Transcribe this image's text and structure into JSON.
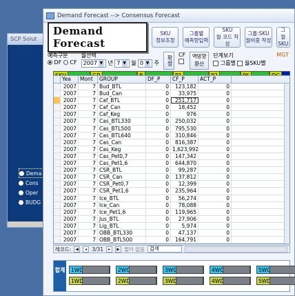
{
  "bg_window": {
    "title": "SCP Solut",
    "radios": [
      "Dema",
      "Cons",
      "Oper",
      "BUDG"
    ]
  },
  "window": {
    "title": "Demand Forecast --> Consensus Forecast",
    "logo": "Demand Forecast",
    "buttons": [
      {
        "l1": "SKU",
        "l2": "정보조정"
      },
      {
        "l1": "그룹별",
        "l2": "예측량입력"
      },
      {
        "l1": "SKU",
        "l2": "월 코드 작성"
      },
      {
        "l1": "그룹:SKU",
        "l2": "월비중 작성"
      },
      {
        "l1": "그",
        "l2": "월SKU"
      }
    ]
  },
  "controls": {
    "pred_type_label": "예측구분",
    "pred_options": [
      "DF",
      "CF"
    ],
    "month_select_label": "월선택",
    "year_value": "2007",
    "year_suffix": "년",
    "month_value": "7",
    "month_suffix": "월",
    "week_value": "0",
    "week_suffix": "주",
    "confirm_label": "확정",
    "cf_label": "CF",
    "reverse_label_1": "역방향",
    "reverse_label_2": "환산",
    "stage_label": "단계보기",
    "stage_options": [
      "그룹별",
      "월SKU별"
    ],
    "mgt_label": "MGT"
  },
  "filters": [
    "SKU",
    "GR",
    "B",
    "P1",
    "P2",
    "PS",
    "DC"
  ],
  "grid": {
    "columns": [
      "Yea",
      "Mont",
      "GROUP",
      "DF_P",
      "CF_P",
      "ACT_P"
    ],
    "rows": [
      [
        "2007",
        "7",
        "Bud_BTL",
        "0",
        "123,182",
        "0"
      ],
      [
        "2007",
        "7",
        "Bud_Can",
        "0",
        "33,975",
        "0"
      ],
      [
        "2007",
        "7",
        "Caf_BTL",
        "0",
        "251,717",
        "0"
      ],
      [
        "2007",
        "7",
        "Caf_Can",
        "0",
        "18,452",
        "0"
      ],
      [
        "2007",
        "7",
        "Caf_Keg",
        "0",
        "976",
        "0"
      ],
      [
        "2007",
        "7",
        "Cas_BTL330",
        "0",
        "250,032",
        "0"
      ],
      [
        "2007",
        "7",
        "Cas_BTL500",
        "0",
        "795,530",
        "0"
      ],
      [
        "2007",
        "7",
        "Cas_BTL640",
        "0",
        "310,846",
        "0"
      ],
      [
        "2007",
        "7",
        "Cas_Can",
        "0",
        "816,387",
        "0"
      ],
      [
        "2007",
        "7",
        "Cas_Keg",
        "0",
        "1,623,992",
        "0"
      ],
      [
        "2007",
        "7",
        "Cas_Pet0,7",
        "0",
        "147,342",
        "0"
      ],
      [
        "2007",
        "7",
        "Cas_Pet1,6",
        "0",
        "644,870",
        "0"
      ],
      [
        "2007",
        "7",
        "CSR_BTL",
        "0",
        "99,287",
        "0"
      ],
      [
        "2007",
        "7",
        "CSR_Can",
        "0",
        "137,812",
        "0"
      ],
      [
        "2007",
        "7",
        "CSR_Pet0,7",
        "0",
        "12,399",
        "0"
      ],
      [
        "2007",
        "7",
        "CSR_Pet1,6",
        "0",
        "235,964",
        "0"
      ],
      [
        "2007",
        "7",
        "Ice_BTL",
        "0",
        "56,274",
        "0"
      ],
      [
        "2007",
        "7",
        "Ice_Can",
        "0",
        "78,088",
        "0"
      ],
      [
        "2007",
        "7",
        "Ice_Pet1,6",
        "0",
        "119,965",
        "0"
      ],
      [
        "2007",
        "7",
        "Jus_BTL",
        "0",
        "27,906",
        "0"
      ],
      [
        "2007",
        "7",
        "Lig_BTL",
        "0",
        "5,974",
        "0"
      ],
      [
        "2007",
        "7",
        "OBB_BTL330",
        "0",
        "47,137",
        "0"
      ],
      [
        "2007",
        "7",
        "OBB_BTL500",
        "0",
        "164,791",
        "0"
      ]
    ],
    "current_row": 2
  },
  "nav": {
    "record_label": "레코드:",
    "record_pos": "3/31",
    "filter_label": "필터 없음",
    "search_label": "검색"
  },
  "summary": {
    "label": "합계",
    "boxes": [
      {
        "label": "1WC",
        "kind": "wc"
      },
      {
        "label": "2WC",
        "kind": "wc"
      },
      {
        "label": "3WC",
        "kind": "wc"
      },
      {
        "label": "4WC",
        "kind": "wc"
      },
      {
        "label": "5WC",
        "kind": "wc"
      },
      {
        "label": "1WD",
        "kind": "wd"
      },
      {
        "label": "2WD",
        "kind": "wd"
      },
      {
        "label": "3WD",
        "kind": "wd"
      },
      {
        "label": "4WD",
        "kind": "wd"
      },
      {
        "label": "5WD",
        "kind": "wd"
      }
    ]
  }
}
